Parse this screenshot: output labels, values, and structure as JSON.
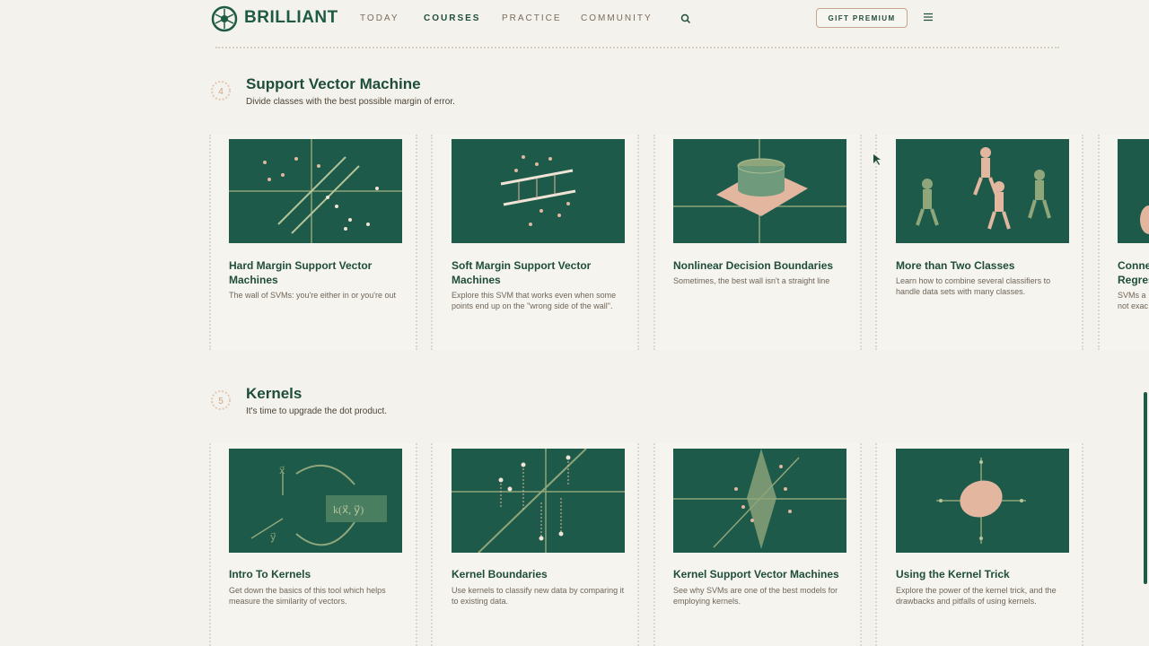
{
  "header": {
    "brand": "BRILLIANT",
    "nav": [
      {
        "label": "TODAY",
        "active": false
      },
      {
        "label": "COURSES",
        "active": true
      },
      {
        "label": "PRACTICE",
        "active": false
      },
      {
        "label": "COMMUNITY",
        "active": false
      }
    ],
    "gift_label": "GIFT PREMIUM",
    "icons": [
      "brilliant-logo-icon",
      "search-icon",
      "menu-icon"
    ]
  },
  "sections": [
    {
      "number": "4",
      "title": "Support Vector Machine",
      "subtitle": "Divide classes with the best possible margin of error.",
      "cards": [
        {
          "title": "Hard Margin Support Vector Machines",
          "desc": "The wall of SVMs: you're either in or you're out"
        },
        {
          "title": "Soft Margin Support Vector Machines",
          "desc": "Explore this SVM that works even when some points end up on the \"wrong side of the wall\"."
        },
        {
          "title": "Nonlinear Decision Boundaries",
          "desc": "Sometimes, the best wall isn't a straight line"
        },
        {
          "title": "More than Two Classes",
          "desc": "Learn how to combine several classifiers to handle data sets with many classes."
        },
        {
          "title": "Conne Regres",
          "desc": "SVMs a not exac"
        }
      ]
    },
    {
      "number": "5",
      "title": "Kernels",
      "subtitle": "It's time to upgrade the dot product.",
      "cards": [
        {
          "title": "Intro To Kernels",
          "desc": "Get down the basics of this tool which helps measure the similarity of vectors."
        },
        {
          "title": "Kernel Boundaries",
          "desc": "Use kernels to classify new data by comparing it to existing data."
        },
        {
          "title": "Kernel Support Vector Machines",
          "desc": "See why SVMs are one of the best models for employing kernels."
        },
        {
          "title": "Using the Kernel Trick",
          "desc": "Explore the power of the kernel trick, and the drawbacks and pitfalls of using kernels."
        }
      ]
    }
  ],
  "thumb_labels": {
    "x_vec": "x⃗",
    "y_vec": "y⃗",
    "kernel_fn": "k(x⃗, y⃗)"
  },
  "colors": {
    "accent": "#1f4d3b",
    "thumb_bg": "#1d5a4a",
    "salmon": "#e3b6a0",
    "border": "#c9a58a"
  }
}
